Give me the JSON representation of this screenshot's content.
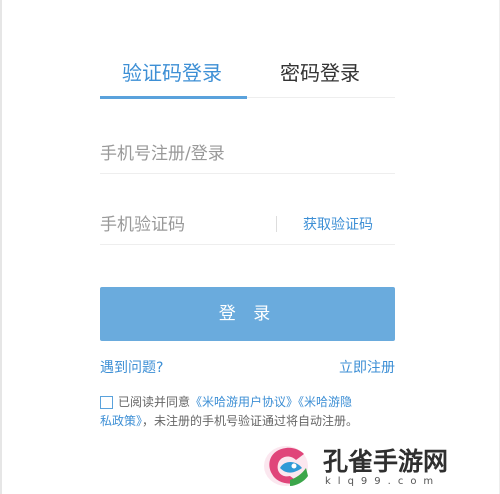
{
  "tabs": {
    "sms_login": "验证码登录",
    "password_login": "密码登录"
  },
  "form": {
    "phone_placeholder": "手机号注册/登录",
    "code_placeholder": "手机验证码",
    "get_code": "获取验证码"
  },
  "login_button": "登 录",
  "links": {
    "help": "遇到问题?",
    "register": "立即注册"
  },
  "agreement": {
    "prefix": "已阅读并同意",
    "user_agreement": "《米哈游用户协议》",
    "privacy_policy_part1": "《米哈游隐",
    "privacy_policy_part2": "私政策》",
    "suffix": "，未注册的手机号验证通过将自动注册。"
  },
  "watermark": {
    "title": "孔雀手游网",
    "url": "klq99.com"
  },
  "colors": {
    "accent": "#3d8fd5",
    "button": "#6aabdd",
    "placeholder": "#999999"
  }
}
